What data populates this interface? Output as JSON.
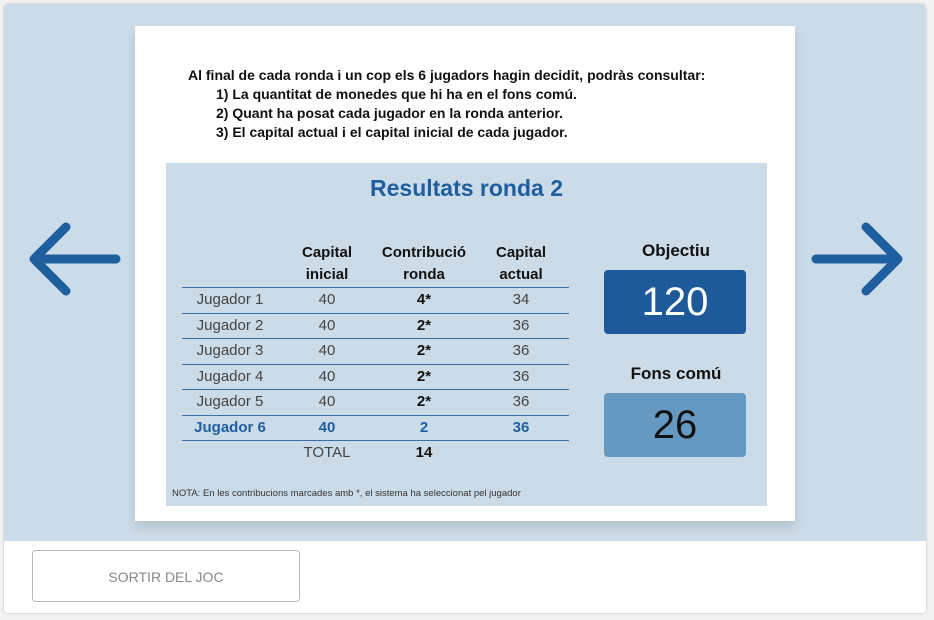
{
  "intro": {
    "line1": "Al final de cada ronda i un cop els 6 jugadors hagin decidit, podràs consultar:",
    "line2": "1) La quantitat de monedes que hi ha en el fons comú.",
    "line3": "2) Quant ha posat cada jugador en la ronda anterior.",
    "line4": "3) El capital actual i el capital inicial de cada jugador."
  },
  "results": {
    "title": "Resultats ronda 2",
    "headers": {
      "capital_inicial": [
        "Capital",
        "inicial"
      ],
      "contribucio": [
        "Contribució",
        "ronda"
      ],
      "capital_actual": [
        "Capital",
        "actual"
      ]
    },
    "rows": [
      {
        "name": "Jugador 1",
        "inicial": "40",
        "contribucio": "4*",
        "actual": "34"
      },
      {
        "name": "Jugador 2",
        "inicial": "40",
        "contribucio": "2*",
        "actual": "36"
      },
      {
        "name": "Jugador 3",
        "inicial": "40",
        "contribucio": "2*",
        "actual": "36"
      },
      {
        "name": "Jugador 4",
        "inicial": "40",
        "contribucio": "2*",
        "actual": "36"
      },
      {
        "name": "Jugador 5",
        "inicial": "40",
        "contribucio": "2*",
        "actual": "36"
      },
      {
        "name": "Jugador 6",
        "inicial": "40",
        "contribucio": "2",
        "actual": "36"
      }
    ],
    "total_label": "TOTAL",
    "total_value": "14",
    "note": "NOTA: En les contribucions marcades amb *, el sistema ha seleccionat pel jugador"
  },
  "objectiu": {
    "label": "Objectiu",
    "value": "120"
  },
  "fons": {
    "label": "Fons comú",
    "value": "26"
  },
  "nav": {
    "prev_icon": "arrow-left-icon",
    "next_icon": "arrow-right-icon"
  },
  "footer": {
    "exit_label": "SORTIR DEL JOC"
  },
  "colors": {
    "accent": "#1f5fa0",
    "objective_box": "#1e5a9a",
    "pool_box": "#6699c1",
    "panel_bg": "#cbdbe7"
  }
}
